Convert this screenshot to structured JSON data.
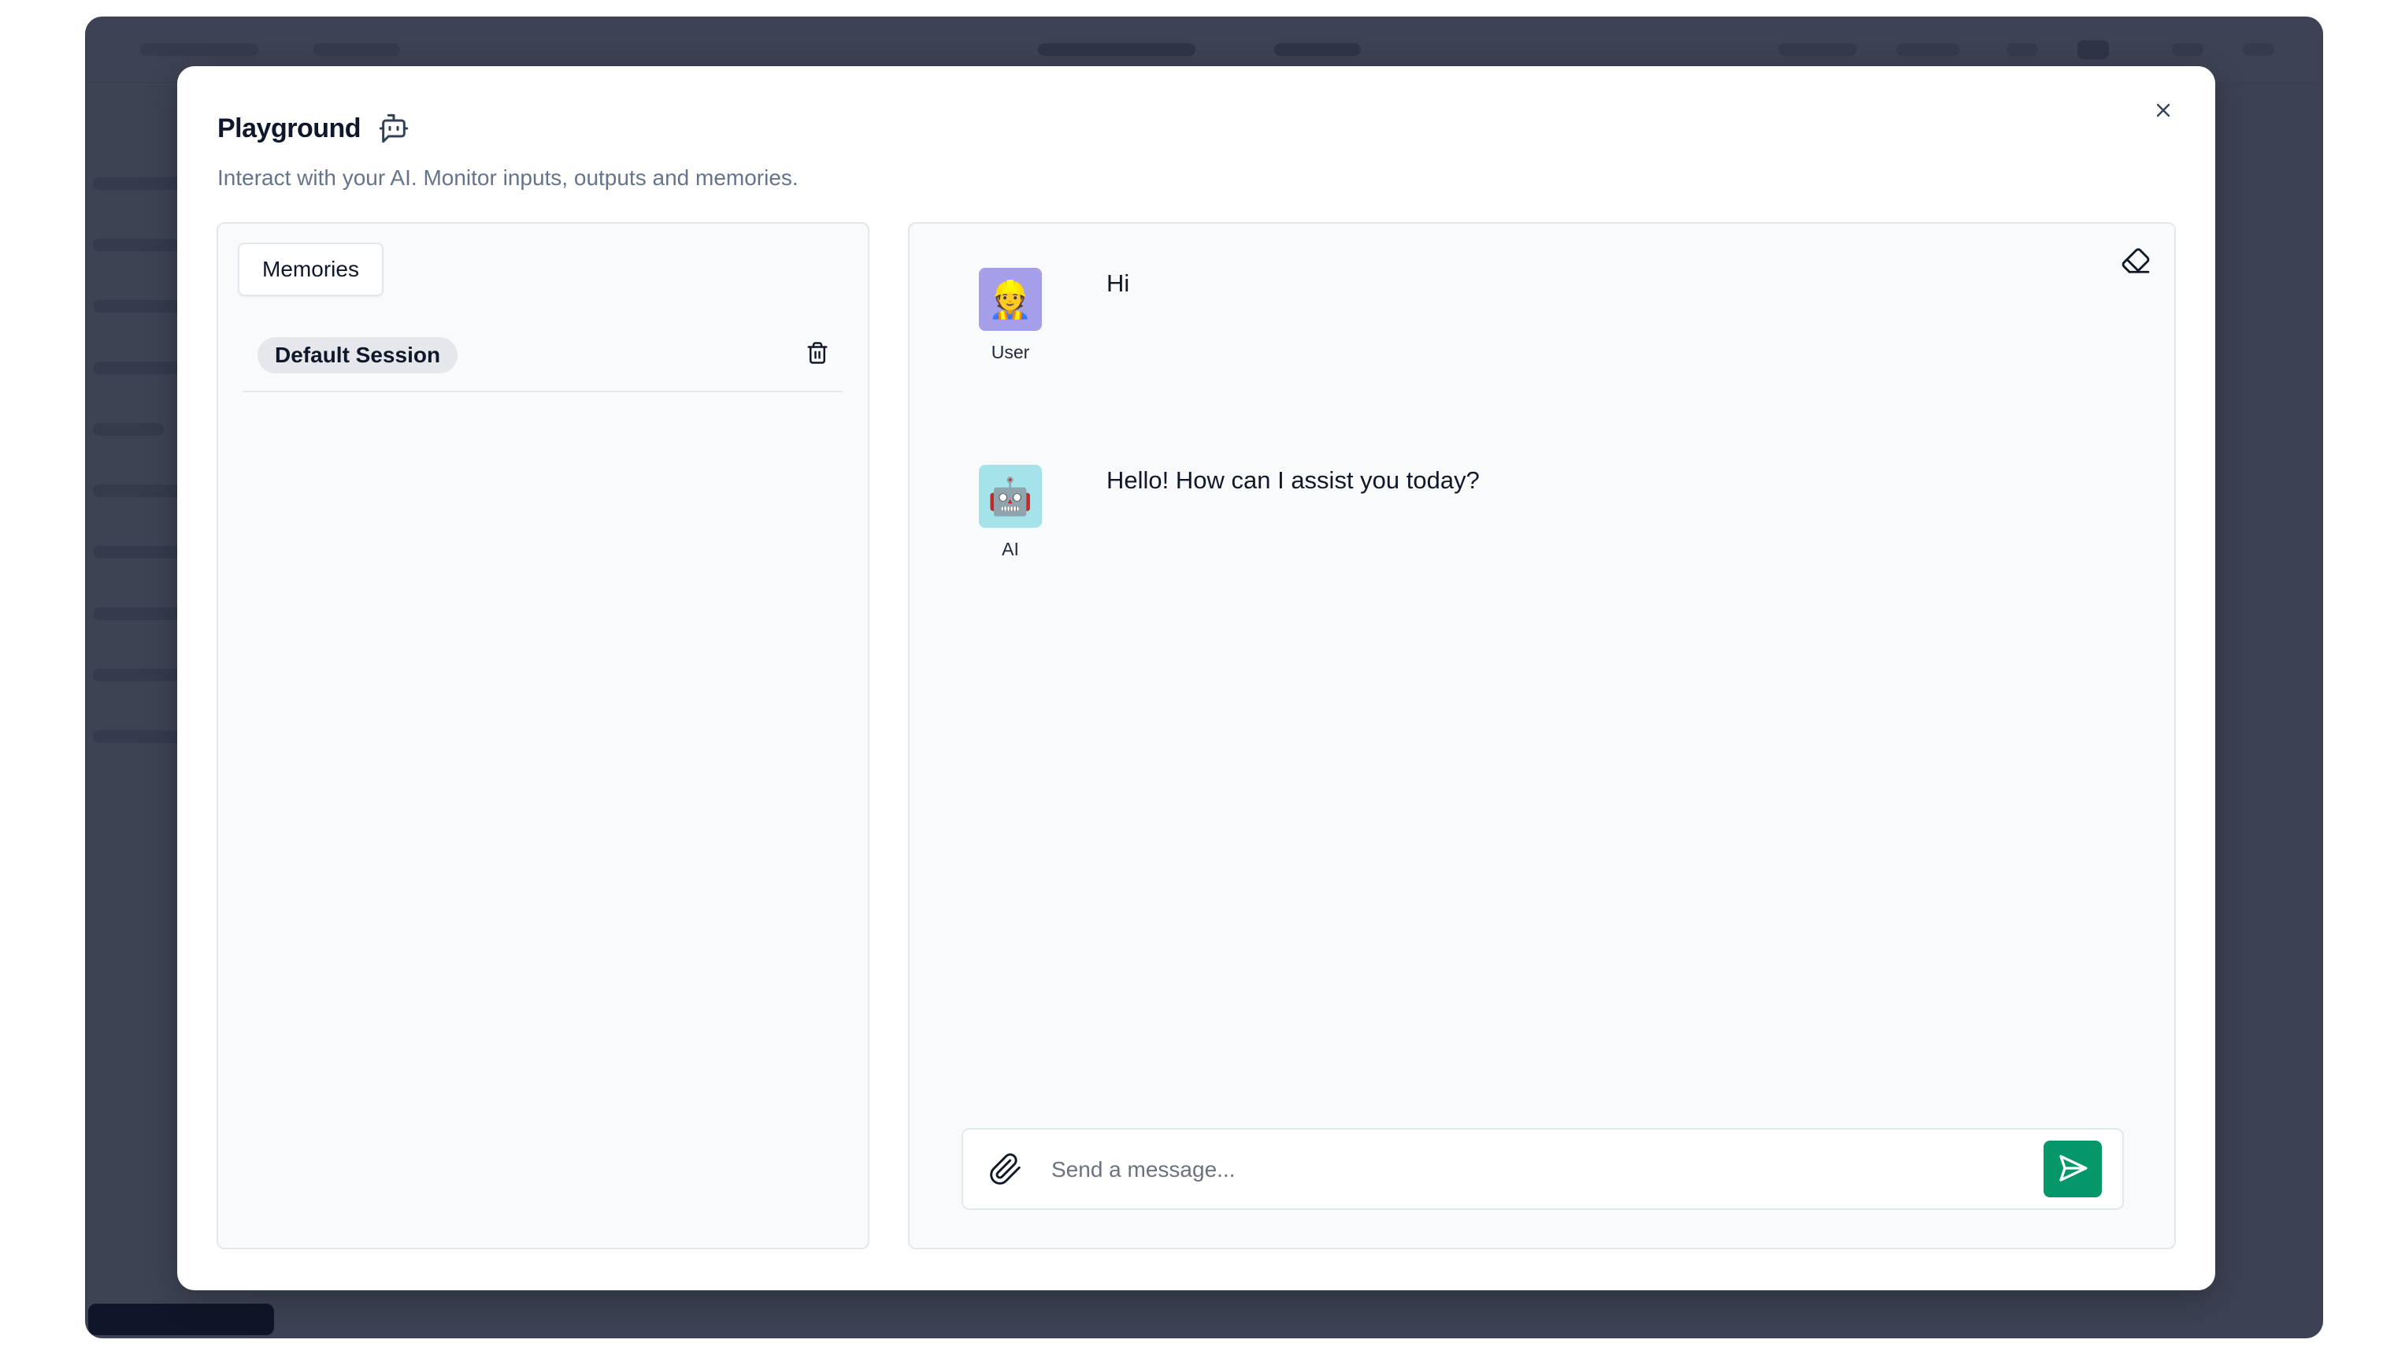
{
  "modal": {
    "title": "Playground",
    "title_icon": "bot-message-icon",
    "subtitle": "Interact with your AI. Monitor inputs, outputs and memories.",
    "close_icon": "close-icon"
  },
  "memories": {
    "tab_label": "Memories",
    "sessions": [
      {
        "label": "Default Session",
        "delete_icon": "trash-icon"
      }
    ]
  },
  "chat": {
    "clear_icon": "eraser-icon",
    "messages": [
      {
        "sender": "User",
        "avatar_emoji": "👷",
        "text": "Hi"
      },
      {
        "sender": "AI",
        "avatar_emoji": "🤖",
        "text": "Hello! How can I assist you today?"
      }
    ],
    "input": {
      "placeholder": "Send a message...",
      "value": "",
      "attach_icon": "paperclip-icon",
      "send_icon": "send-icon"
    }
  },
  "colors": {
    "send_button": "#059669",
    "user_avatar_bg": "#a59ee8",
    "ai_avatar_bg": "#a5e3ea",
    "overlay": "#0f172a"
  }
}
